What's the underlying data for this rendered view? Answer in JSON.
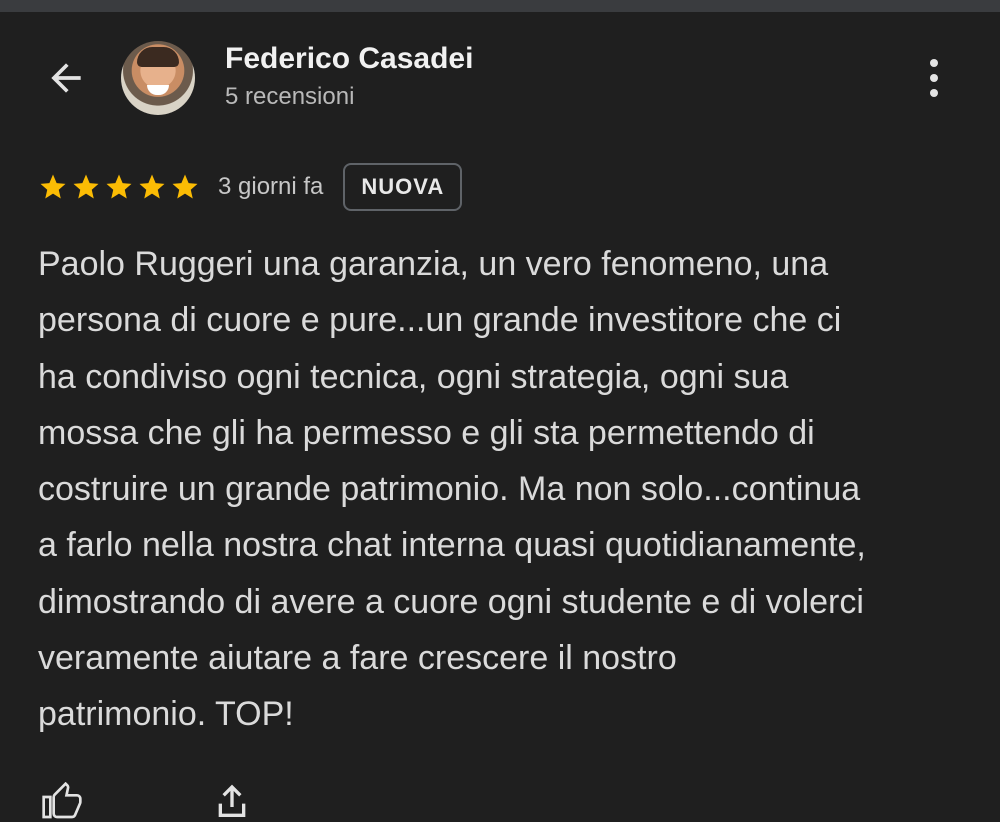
{
  "reviewer": {
    "name": "Federico Casadei",
    "reviews_count": "5 recensioni"
  },
  "icons": {
    "back": "arrow-back-icon",
    "more": "more-vertical-icon",
    "like": "thumbs-up-icon",
    "share": "share-icon"
  },
  "review": {
    "rating": 5,
    "max_rating": 5,
    "time_ago": "3 giorni fa",
    "badge": "NUOVA",
    "text": "Paolo Ruggeri una garanzia, un vero fenomeno, una\npersona di cuore e pure...un grande investitore che ci\nha condiviso ogni tecnica, ogni strategia, ogni sua\nmossa che gli ha permesso e gli sta permettendo di\ncostruire un grande patrimonio. Ma non solo...continua\na farlo nella nostra chat interna quasi quotidianamente,\ndimostrando di avere a cuore ogni studente e di volerci\nveramente aiutare a fare crescere il nostro\npatrimonio. TOP!"
  },
  "colors": {
    "background": "#1f1f1f",
    "star": "#fbbc04",
    "text": "#dadada",
    "muted": "#b9b9b9"
  }
}
